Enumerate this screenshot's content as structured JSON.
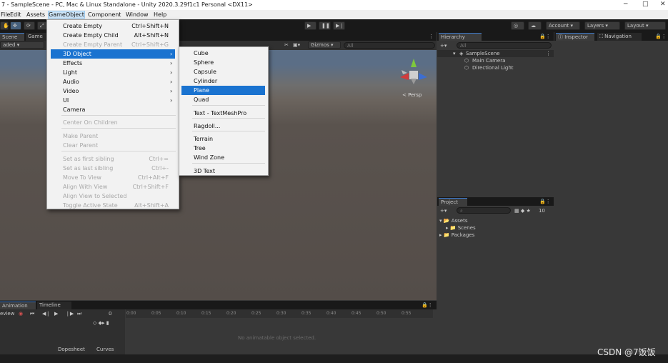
{
  "window": {
    "title": "7 - SampleScene - PC, Mac & Linux Standalone - Unity 2020.3.29f1c1 Personal <DX11>",
    "minimize": "─",
    "maximize": "□",
    "close": "✕"
  },
  "menubar": {
    "items": [
      "File",
      "Edit",
      "Assets",
      "GameObject",
      "Component",
      "Window",
      "Help"
    ]
  },
  "toolbar": {
    "tools": [
      "hand-icon",
      "move-icon",
      "rotate-icon",
      "scale-icon"
    ],
    "play": "▶",
    "pause": "❚❚",
    "step": "▶❘",
    "collab": "◎",
    "cloud": "☁",
    "account": "Account",
    "layers": "Layers",
    "layout": "Layout"
  },
  "scene": {
    "tabs": [
      "Scene",
      "Game"
    ],
    "shading": "aded",
    "gizmos": "Gizmos",
    "search": "All",
    "persp": "< Persp"
  },
  "hierarchy": {
    "tab": "Hierarchy",
    "search": "All",
    "scene": "SampleScene",
    "items": [
      "Main Camera",
      "Directional Light"
    ]
  },
  "inspector": {
    "tabs": [
      "Inspector",
      "Navigation"
    ]
  },
  "project": {
    "tab": "Project",
    "count": "10",
    "tree": [
      "Assets",
      "Scenes",
      "Packages"
    ]
  },
  "animation": {
    "tabs": [
      "Animation",
      "Timeline"
    ],
    "preview": "eview",
    "frame": "0",
    "ticks": [
      "0:00",
      "0:05",
      "0:10",
      "0:15",
      "0:20",
      "0:25",
      "0:30",
      "0:35",
      "0:40",
      "0:45",
      "0:50",
      "0:55"
    ],
    "message": "No animatable object selected.",
    "bottom_tabs": [
      "Dopesheet",
      "Curves"
    ]
  },
  "menu": {
    "items": [
      {
        "label": "Create Empty",
        "shortcut": "Ctrl+Shift+N",
        "enabled": true
      },
      {
        "label": "Create Empty Child",
        "shortcut": "Alt+Shift+N",
        "enabled": true
      },
      {
        "label": "Create Empty Parent",
        "shortcut": "Ctrl+Shift+G",
        "enabled": false
      },
      {
        "label": "3D Object",
        "shortcut": "",
        "enabled": true,
        "submenu": true,
        "highlighted": true
      },
      {
        "label": "Effects",
        "shortcut": "",
        "enabled": true,
        "submenu": true
      },
      {
        "label": "Light",
        "shortcut": "",
        "enabled": true,
        "submenu": true
      },
      {
        "label": "Audio",
        "shortcut": "",
        "enabled": true,
        "submenu": true
      },
      {
        "label": "Video",
        "shortcut": "",
        "enabled": true,
        "submenu": true
      },
      {
        "label": "UI",
        "shortcut": "",
        "enabled": true,
        "submenu": true
      },
      {
        "label": "Camera",
        "shortcut": "",
        "enabled": true
      },
      {
        "label": "Center On Children",
        "shortcut": "",
        "enabled": false
      },
      {
        "label": "Make Parent",
        "shortcut": "",
        "enabled": false
      },
      {
        "label": "Clear Parent",
        "shortcut": "",
        "enabled": false
      },
      {
        "label": "Set as first sibling",
        "shortcut": "Ctrl+=",
        "enabled": false
      },
      {
        "label": "Set as last sibling",
        "shortcut": "Ctrl+-",
        "enabled": false
      },
      {
        "label": "Move To View",
        "shortcut": "Ctrl+Alt+F",
        "enabled": false
      },
      {
        "label": "Align With View",
        "shortcut": "Ctrl+Shift+F",
        "enabled": false
      },
      {
        "label": "Align View to Selected",
        "shortcut": "",
        "enabled": false
      },
      {
        "label": "Toggle Active State",
        "shortcut": "Alt+Shift+A",
        "enabled": false
      }
    ]
  },
  "submenu": {
    "items": [
      "Cube",
      "Sphere",
      "Capsule",
      "Cylinder",
      "Plane",
      "Quad",
      "Text - TextMeshPro",
      "Ragdoll...",
      "Terrain",
      "Tree",
      "Wind Zone",
      "3D Text"
    ],
    "highlighted": "Plane"
  },
  "watermark": "CSDN @7饭饭",
  "colors": {
    "highlight": "#1a73d0",
    "gizmo_x": "#d23c3c",
    "gizmo_y": "#7ec83c",
    "gizmo_z": "#3c6ed2"
  }
}
